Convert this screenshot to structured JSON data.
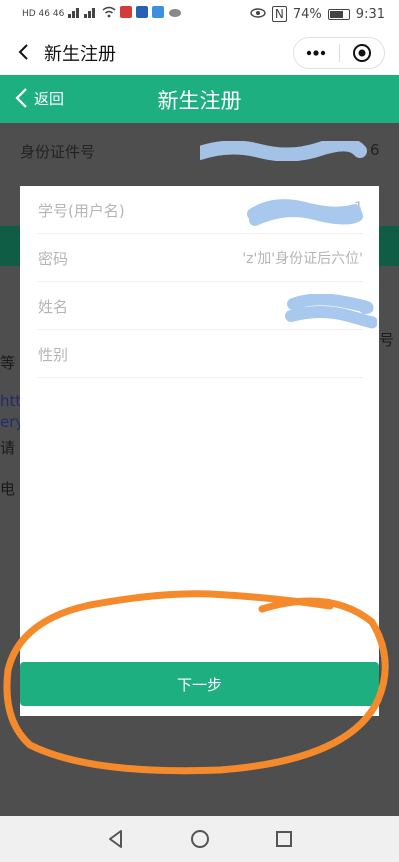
{
  "status_bar": {
    "network_left": "HD 46 46",
    "nfc": "N",
    "battery_percent": 74,
    "battery_text": "74%",
    "time": "9:31"
  },
  "title_bar": {
    "title": "新生注册"
  },
  "header": {
    "back_label": "返回",
    "title": "新生注册",
    "color": "#1eaf80"
  },
  "background_page": {
    "id_label": "身份证件号",
    "id_value_visible": "6",
    "fragment_right": "号",
    "fragment_deng": "等",
    "link_line1": "htt",
    "link_line2": "ery",
    "fragment_qing": "请",
    "fragment_dian": "电"
  },
  "modal": {
    "fields": [
      {
        "label": "学号(用户名)",
        "value": "1"
      },
      {
        "label": "密码",
        "value": "'z'加'身份证后六位'"
      },
      {
        "label": "姓名",
        "value": ""
      },
      {
        "label": "性别",
        "value": ""
      }
    ],
    "next_button": "下一步"
  },
  "annotation_color": "#f58a2c"
}
